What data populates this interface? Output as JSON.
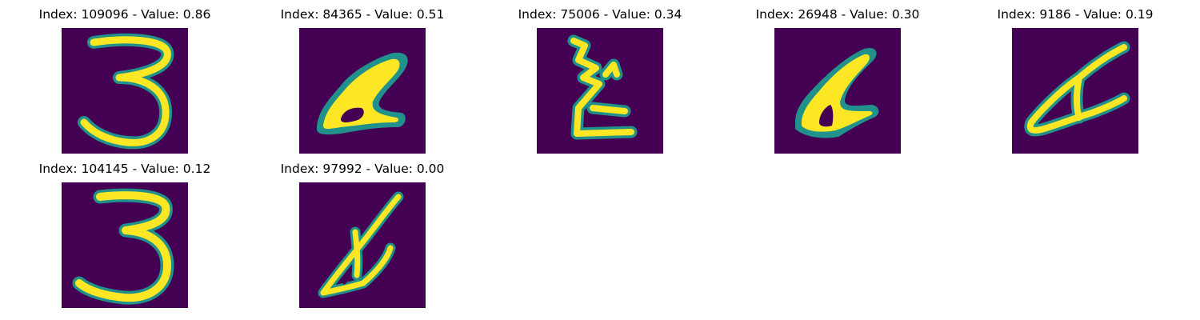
{
  "figure": {
    "panels": [
      {
        "title": "Index: 109096 - Value: 0.86",
        "index": 109096,
        "value": 0.86,
        "glyph": "digit-three-image"
      },
      {
        "title": "Index: 84365 - Value: 0.51",
        "index": 84365,
        "value": 0.51,
        "glyph": "blob-stroke-image"
      },
      {
        "title": "Index: 75006 - Value: 0.34",
        "index": 75006,
        "value": 0.34,
        "glyph": "z-like-stroke-image"
      },
      {
        "title": "Index: 26948 - Value: 0.30",
        "index": 26948,
        "value": 0.3,
        "glyph": "blob-stroke-image"
      },
      {
        "title": "Index: 9186 - Value: 0.19",
        "index": 9186,
        "value": 0.19,
        "glyph": "slanted-stroke-image"
      },
      {
        "title": "Index: 104145 - Value: 0.12",
        "index": 104145,
        "value": 0.12,
        "glyph": "digit-three-image"
      },
      {
        "title": "Index: 97992 - Value: 0.00",
        "index": 97992,
        "value": 0.0,
        "glyph": "slanted-stroke-image"
      }
    ],
    "colors": {
      "background": "#440154",
      "stroke_core": "#fde725",
      "stroke_edge": "#21918c"
    }
  }
}
